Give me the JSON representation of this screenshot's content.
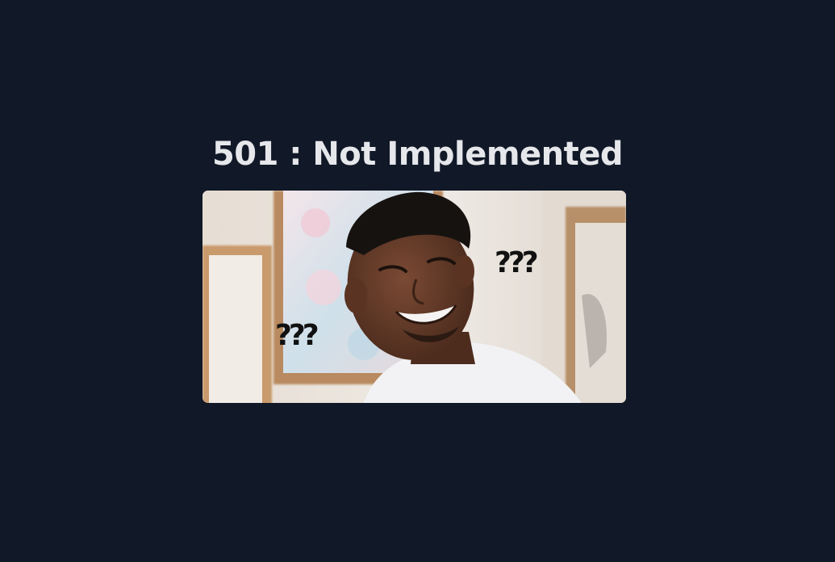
{
  "error": {
    "title": "501 : Not Implemented"
  },
  "meme": {
    "caption_left": "???",
    "caption_right": "???"
  }
}
